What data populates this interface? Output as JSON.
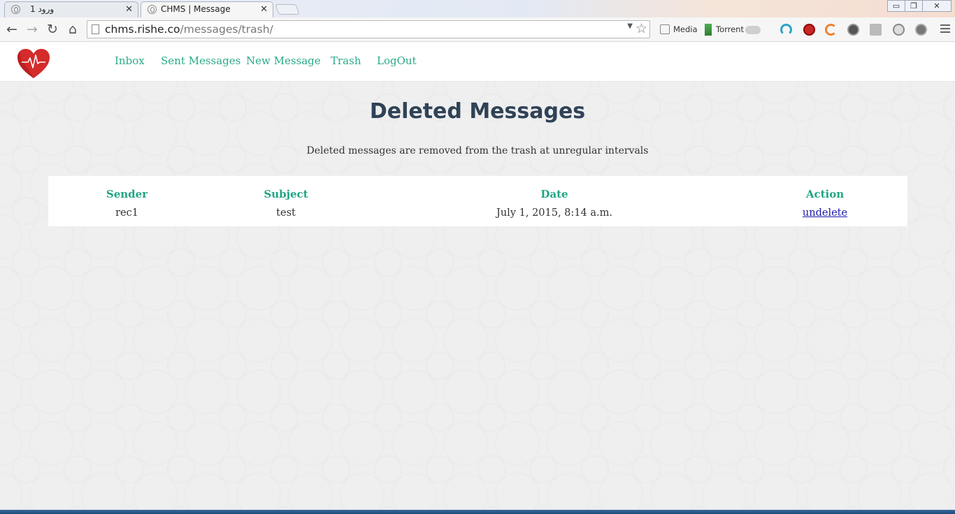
{
  "browser": {
    "tabs": [
      {
        "title": "ورود 1",
        "active": false
      },
      {
        "title": "CHMS | Message",
        "active": true
      }
    ],
    "url_host": "chms.rishe.co",
    "url_path": "/messages/trash/",
    "extensions": {
      "media_label": "Media",
      "torrent_label": "Torrent"
    },
    "window_controls": {
      "minimize": "▭",
      "restore": "❐",
      "close": "✕"
    }
  },
  "site": {
    "nav": [
      {
        "label": "Inbox"
      },
      {
        "label": "Sent Messages"
      },
      {
        "label": "New Message"
      },
      {
        "label": "Trash"
      },
      {
        "label": "LogOut"
      }
    ],
    "logo_icon": "heart-pulse-icon",
    "accent_color": "#2aaa8a",
    "title_color": "#2f4256"
  },
  "main": {
    "title": "Deleted Messages",
    "note": "Deleted messages are removed from the trash at unregular intervals",
    "table": {
      "headers": [
        "Sender",
        "Subject",
        "Date",
        "Action"
      ],
      "rows": [
        {
          "sender": "rec1",
          "subject": "test",
          "date": "July 1, 2015, 8:14 a.m.",
          "action": "undelete"
        }
      ]
    }
  }
}
